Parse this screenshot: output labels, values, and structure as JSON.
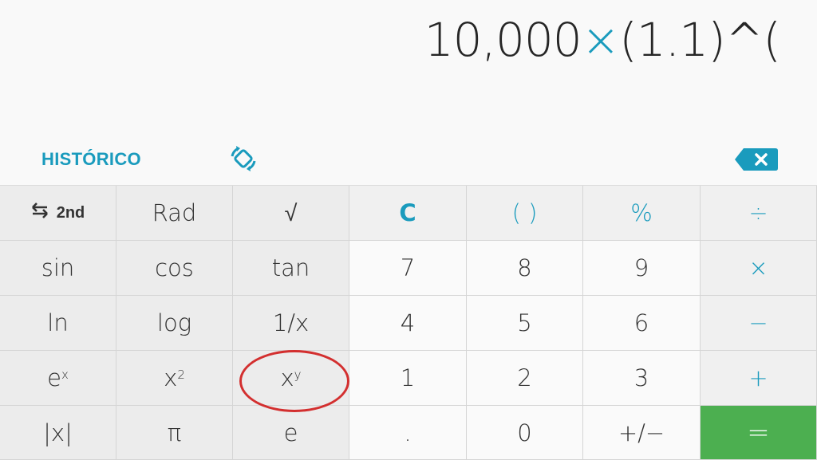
{
  "display": {
    "expression_parts": [
      "10,000",
      "×",
      "(1.1)^("
    ]
  },
  "toolbar": {
    "history_label": "HISTÓRICO",
    "rotate_icon": "screen-rotation-icon",
    "backspace_icon": "backspace-icon"
  },
  "colors": {
    "accent": "#1a9bbd",
    "equals_bg": "#4caf50",
    "annotation": "#d32f2f"
  },
  "keys": {
    "second": "2nd",
    "rad": "Rad",
    "sqrt": "√",
    "clear": "C",
    "parens": "( )",
    "percent": "%",
    "divide": "÷",
    "sin": "sin",
    "cos": "cos",
    "tan": "tan",
    "seven": "7",
    "eight": "8",
    "nine": "9",
    "multiply": "×",
    "ln": "ln",
    "log": "log",
    "reciprocal": "1/x",
    "four": "4",
    "five": "5",
    "six": "6",
    "minus": "−",
    "exp_base": "e",
    "exp_sup": "x",
    "square_base": "x",
    "square_sup": "2",
    "power_base": "x",
    "power_sup": "y",
    "one": "1",
    "two": "2",
    "three": "3",
    "plus": "+",
    "abs": "|x|",
    "pi": "π",
    "e": "e",
    "dot": ".",
    "zero": "0",
    "negate": "+/−",
    "equals": "="
  },
  "annotation": {
    "highlighted_key": "x^y"
  }
}
